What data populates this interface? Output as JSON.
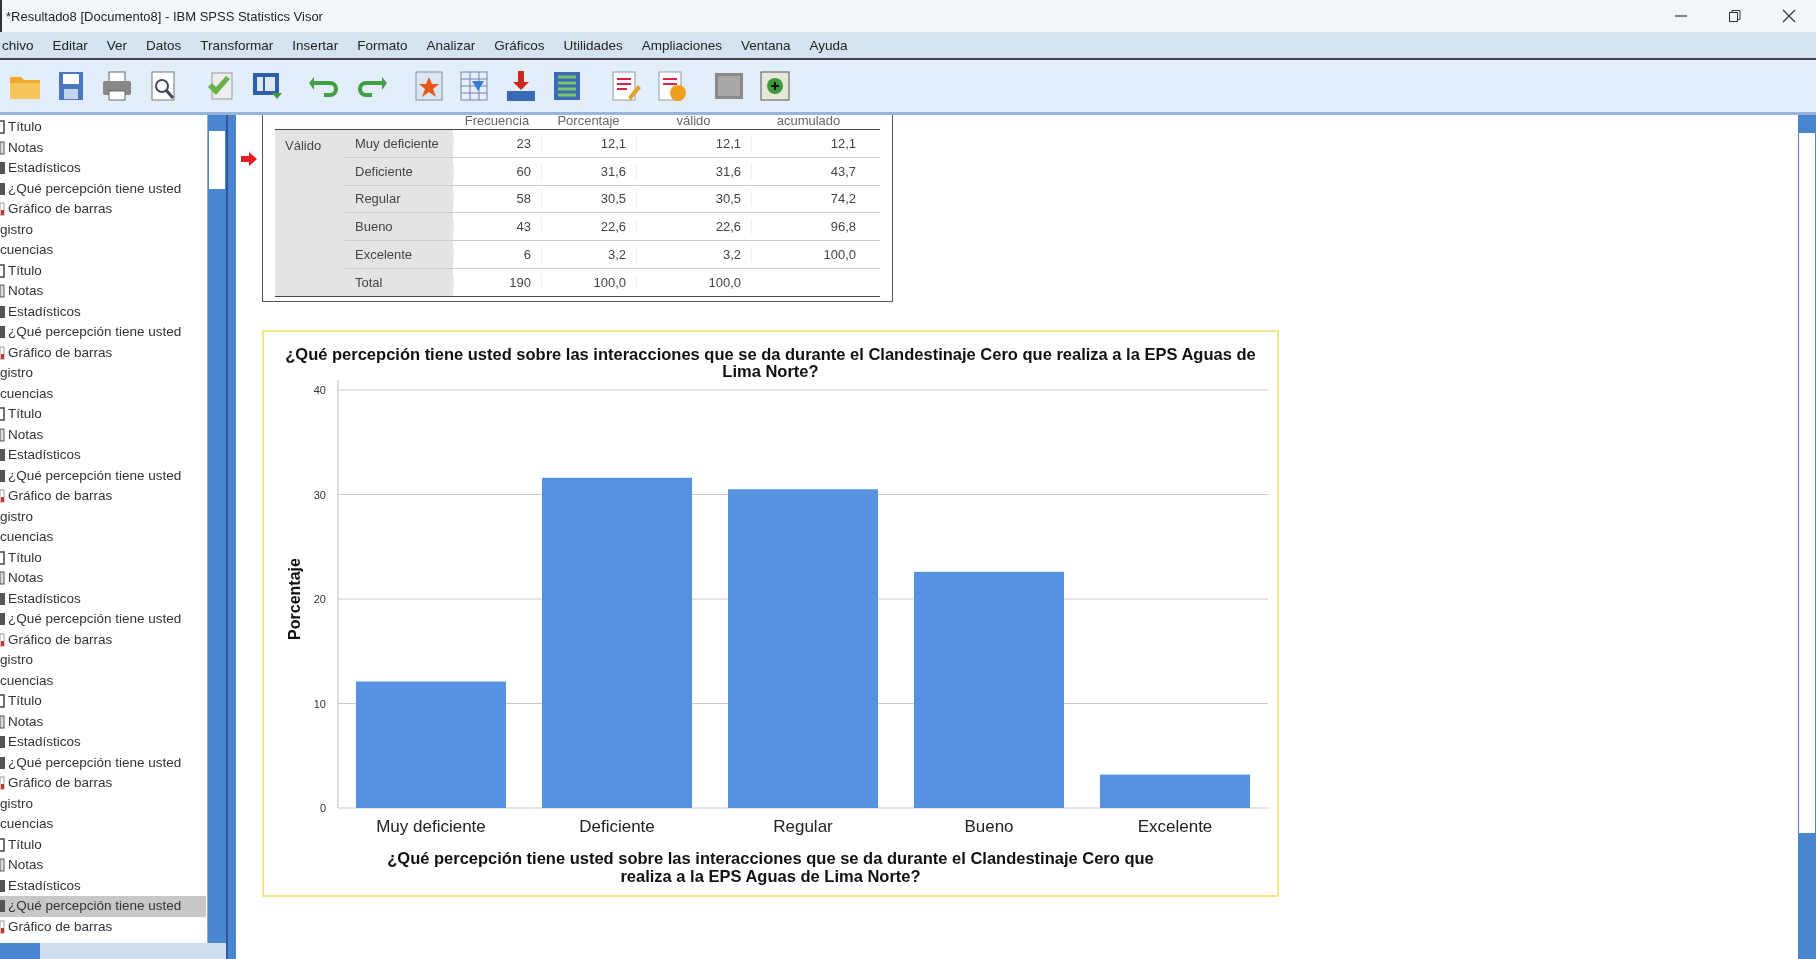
{
  "window": {
    "title": "*Resultado8 [Documento8] - IBM SPSS Statistics Visor"
  },
  "menu": [
    "chivo",
    "Editar",
    "Ver",
    "Datos",
    "Transformar",
    "Insertar",
    "Formato",
    "Analizar",
    "Gráficos",
    "Utilidades",
    "Ampliaciones",
    "Ventana",
    "Ayuda"
  ],
  "sidebar": {
    "items": [
      {
        "label": "Título",
        "kind": "title",
        "selected": false
      },
      {
        "label": "Notas",
        "kind": "notes",
        "selected": false
      },
      {
        "label": "Estadísticos",
        "kind": "table",
        "selected": false
      },
      {
        "label": "¿Qué percepción tiene usted",
        "kind": "table",
        "selected": false
      },
      {
        "label": "Gráfico de barras",
        "kind": "chart",
        "selected": false
      },
      {
        "label": "gistro",
        "kind": "node",
        "selected": false
      },
      {
        "label": "cuencias",
        "kind": "node",
        "selected": false,
        "children": [
          {
            "label": "Título",
            "kind": "title",
            "selected": false
          },
          {
            "label": "Notas",
            "kind": "notes",
            "selected": false
          },
          {
            "label": "Estadísticos",
            "kind": "table",
            "selected": false
          },
          {
            "label": "¿Qué percepción tiene usted",
            "kind": "table",
            "selected": false
          },
          {
            "label": "Gráfico de barras",
            "kind": "chart",
            "selected": false
          }
        ]
      },
      {
        "label": "gistro",
        "kind": "node",
        "selected": false
      },
      {
        "label": "cuencias",
        "kind": "node",
        "selected": false,
        "children": [
          {
            "label": "Título",
            "kind": "title",
            "selected": false
          },
          {
            "label": "Notas",
            "kind": "notes",
            "selected": false
          },
          {
            "label": "Estadísticos",
            "kind": "table",
            "selected": false
          },
          {
            "label": "¿Qué percepción tiene usted",
            "kind": "table",
            "selected": false
          },
          {
            "label": "Gráfico de barras",
            "kind": "chart",
            "selected": false
          }
        ]
      },
      {
        "label": "gistro",
        "kind": "node",
        "selected": false
      },
      {
        "label": "cuencias",
        "kind": "node",
        "selected": false,
        "children": [
          {
            "label": "Título",
            "kind": "title",
            "selected": false
          },
          {
            "label": "Notas",
            "kind": "notes",
            "selected": false
          },
          {
            "label": "Estadísticos",
            "kind": "table",
            "selected": false
          },
          {
            "label": "¿Qué percepción tiene usted",
            "kind": "table",
            "selected": false
          },
          {
            "label": "Gráfico de barras",
            "kind": "chart",
            "selected": false
          }
        ]
      },
      {
        "label": "gistro",
        "kind": "node",
        "selected": false
      },
      {
        "label": "cuencias",
        "kind": "node",
        "selected": false,
        "children": [
          {
            "label": "Título",
            "kind": "title",
            "selected": false
          },
          {
            "label": "Notas",
            "kind": "notes",
            "selected": false
          },
          {
            "label": "Estadísticos",
            "kind": "table",
            "selected": false
          },
          {
            "label": "¿Qué percepción tiene usted",
            "kind": "table",
            "selected": false
          },
          {
            "label": "Gráfico de barras",
            "kind": "chart",
            "selected": false
          }
        ]
      },
      {
        "label": "gistro",
        "kind": "node",
        "selected": false
      },
      {
        "label": "cuencias",
        "kind": "node",
        "selected": false,
        "children": [
          {
            "label": "Título",
            "kind": "title",
            "selected": false
          },
          {
            "label": "Notas",
            "kind": "notes",
            "selected": false
          },
          {
            "label": "Estadísticos",
            "kind": "table",
            "selected": false
          },
          {
            "label": "¿Qué percepción tiene usted",
            "kind": "table",
            "selected": true
          },
          {
            "label": "Gráfico de barras",
            "kind": "chart",
            "selected": false
          }
        ]
      }
    ]
  },
  "table": {
    "columns": [
      "Frecuencia",
      "Porcentaje",
      "válido",
      "acumulado"
    ],
    "group_label": "Válido",
    "rows": [
      {
        "label": "Muy deficiente",
        "cells": [
          "23",
          "12,1",
          "12,1",
          "12,1"
        ]
      },
      {
        "label": "Deficiente",
        "cells": [
          "60",
          "31,6",
          "31,6",
          "43,7"
        ]
      },
      {
        "label": "Regular",
        "cells": [
          "58",
          "30,5",
          "30,5",
          "74,2"
        ]
      },
      {
        "label": "Bueno",
        "cells": [
          "43",
          "22,6",
          "22,6",
          "96,8"
        ]
      },
      {
        "label": "Excelente",
        "cells": [
          "6",
          "3,2",
          "3,2",
          "100,0"
        ]
      },
      {
        "label": "Total",
        "cells": [
          "190",
          "100,0",
          "100,0"
        ]
      }
    ]
  },
  "chart": {
    "chart_data": {
      "type": "bar",
      "title": "¿Qué percepción tiene usted sobre las interacciones que se da durante el Clandestinaje Cero que realiza a la EPS Aguas de Lima Norte?",
      "xlabel": "¿Qué percepción tiene usted sobre las interacciones que se da durante el Clandestinaje Cero que realiza a la EPS Aguas de Lima Norte?",
      "ylabel": "Porcentaje",
      "categories": [
        "Muy deficiente",
        "Deficiente",
        "Regular",
        "Bueno",
        "Excelente"
      ],
      "values": [
        12.1,
        31.6,
        30.5,
        22.6,
        3.2
      ],
      "grid": true,
      "ylim": [
        0,
        40
      ],
      "yticks": [
        0,
        10,
        20,
        30,
        40
      ]
    }
  }
}
